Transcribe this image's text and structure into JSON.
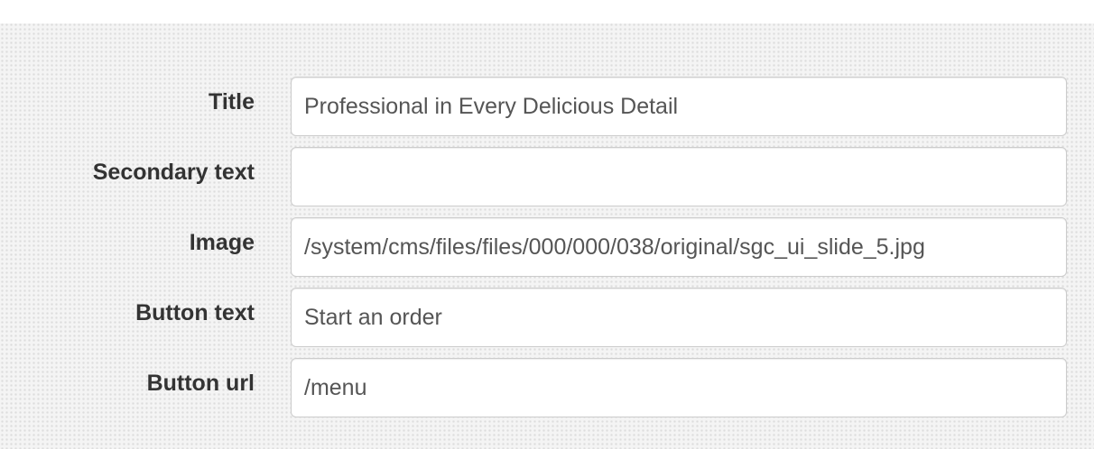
{
  "form": {
    "fields": [
      {
        "label": "Title",
        "value": "Professional in Every Delicious Detail",
        "placeholder": ""
      },
      {
        "label": "Secondary text",
        "value": "",
        "placeholder": ""
      },
      {
        "label": "Image",
        "value": "/system/cms/files/files/000/000/038/original/sgc_ui_slide_5.jpg",
        "placeholder": ""
      },
      {
        "label": "Button text",
        "value": "Start an order",
        "placeholder": ""
      },
      {
        "label": "Button url",
        "value": "/menu",
        "placeholder": ""
      }
    ]
  }
}
